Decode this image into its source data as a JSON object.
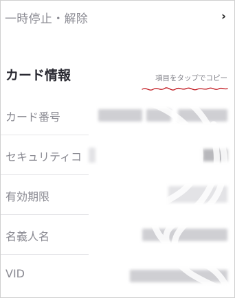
{
  "top_row": {
    "label": "一時停止・解除",
    "chevron": "›"
  },
  "card_section": {
    "title": "カード情報",
    "copy_hint": "項目をタップでコピー",
    "rows": [
      {
        "label": "カード番号"
      },
      {
        "label": "セキュリティコ"
      },
      {
        "label": "有効期限"
      },
      {
        "label": "名義人名"
      },
      {
        "label": "VID"
      }
    ]
  },
  "colors": {
    "label_gray": "#8a8a92",
    "title_dark": "#2a2a32",
    "annotation_red": "#c0141b"
  },
  "icons": {
    "chevron": "chevron-right-icon"
  }
}
